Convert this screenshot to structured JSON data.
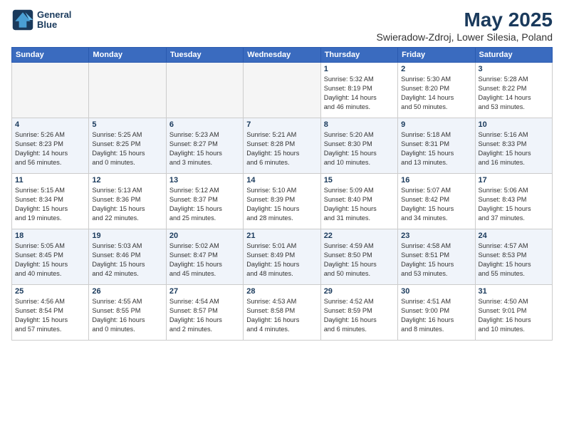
{
  "header": {
    "logo_line1": "General",
    "logo_line2": "Blue",
    "title": "May 2025",
    "subtitle": "Swieradow-Zdroj, Lower Silesia, Poland"
  },
  "weekdays": [
    "Sunday",
    "Monday",
    "Tuesday",
    "Wednesday",
    "Thursday",
    "Friday",
    "Saturday"
  ],
  "weeks": [
    [
      {
        "day": "",
        "info": ""
      },
      {
        "day": "",
        "info": ""
      },
      {
        "day": "",
        "info": ""
      },
      {
        "day": "",
        "info": ""
      },
      {
        "day": "1",
        "info": "Sunrise: 5:32 AM\nSunset: 8:19 PM\nDaylight: 14 hours\nand 46 minutes."
      },
      {
        "day": "2",
        "info": "Sunrise: 5:30 AM\nSunset: 8:20 PM\nDaylight: 14 hours\nand 50 minutes."
      },
      {
        "day": "3",
        "info": "Sunrise: 5:28 AM\nSunset: 8:22 PM\nDaylight: 14 hours\nand 53 minutes."
      }
    ],
    [
      {
        "day": "4",
        "info": "Sunrise: 5:26 AM\nSunset: 8:23 PM\nDaylight: 14 hours\nand 56 minutes."
      },
      {
        "day": "5",
        "info": "Sunrise: 5:25 AM\nSunset: 8:25 PM\nDaylight: 15 hours\nand 0 minutes."
      },
      {
        "day": "6",
        "info": "Sunrise: 5:23 AM\nSunset: 8:27 PM\nDaylight: 15 hours\nand 3 minutes."
      },
      {
        "day": "7",
        "info": "Sunrise: 5:21 AM\nSunset: 8:28 PM\nDaylight: 15 hours\nand 6 minutes."
      },
      {
        "day": "8",
        "info": "Sunrise: 5:20 AM\nSunset: 8:30 PM\nDaylight: 15 hours\nand 10 minutes."
      },
      {
        "day": "9",
        "info": "Sunrise: 5:18 AM\nSunset: 8:31 PM\nDaylight: 15 hours\nand 13 minutes."
      },
      {
        "day": "10",
        "info": "Sunrise: 5:16 AM\nSunset: 8:33 PM\nDaylight: 15 hours\nand 16 minutes."
      }
    ],
    [
      {
        "day": "11",
        "info": "Sunrise: 5:15 AM\nSunset: 8:34 PM\nDaylight: 15 hours\nand 19 minutes."
      },
      {
        "day": "12",
        "info": "Sunrise: 5:13 AM\nSunset: 8:36 PM\nDaylight: 15 hours\nand 22 minutes."
      },
      {
        "day": "13",
        "info": "Sunrise: 5:12 AM\nSunset: 8:37 PM\nDaylight: 15 hours\nand 25 minutes."
      },
      {
        "day": "14",
        "info": "Sunrise: 5:10 AM\nSunset: 8:39 PM\nDaylight: 15 hours\nand 28 minutes."
      },
      {
        "day": "15",
        "info": "Sunrise: 5:09 AM\nSunset: 8:40 PM\nDaylight: 15 hours\nand 31 minutes."
      },
      {
        "day": "16",
        "info": "Sunrise: 5:07 AM\nSunset: 8:42 PM\nDaylight: 15 hours\nand 34 minutes."
      },
      {
        "day": "17",
        "info": "Sunrise: 5:06 AM\nSunset: 8:43 PM\nDaylight: 15 hours\nand 37 minutes."
      }
    ],
    [
      {
        "day": "18",
        "info": "Sunrise: 5:05 AM\nSunset: 8:45 PM\nDaylight: 15 hours\nand 40 minutes."
      },
      {
        "day": "19",
        "info": "Sunrise: 5:03 AM\nSunset: 8:46 PM\nDaylight: 15 hours\nand 42 minutes."
      },
      {
        "day": "20",
        "info": "Sunrise: 5:02 AM\nSunset: 8:47 PM\nDaylight: 15 hours\nand 45 minutes."
      },
      {
        "day": "21",
        "info": "Sunrise: 5:01 AM\nSunset: 8:49 PM\nDaylight: 15 hours\nand 48 minutes."
      },
      {
        "day": "22",
        "info": "Sunrise: 4:59 AM\nSunset: 8:50 PM\nDaylight: 15 hours\nand 50 minutes."
      },
      {
        "day": "23",
        "info": "Sunrise: 4:58 AM\nSunset: 8:51 PM\nDaylight: 15 hours\nand 53 minutes."
      },
      {
        "day": "24",
        "info": "Sunrise: 4:57 AM\nSunset: 8:53 PM\nDaylight: 15 hours\nand 55 minutes."
      }
    ],
    [
      {
        "day": "25",
        "info": "Sunrise: 4:56 AM\nSunset: 8:54 PM\nDaylight: 15 hours\nand 57 minutes."
      },
      {
        "day": "26",
        "info": "Sunrise: 4:55 AM\nSunset: 8:55 PM\nDaylight: 16 hours\nand 0 minutes."
      },
      {
        "day": "27",
        "info": "Sunrise: 4:54 AM\nSunset: 8:57 PM\nDaylight: 16 hours\nand 2 minutes."
      },
      {
        "day": "28",
        "info": "Sunrise: 4:53 AM\nSunset: 8:58 PM\nDaylight: 16 hours\nand 4 minutes."
      },
      {
        "day": "29",
        "info": "Sunrise: 4:52 AM\nSunset: 8:59 PM\nDaylight: 16 hours\nand 6 minutes."
      },
      {
        "day": "30",
        "info": "Sunrise: 4:51 AM\nSunset: 9:00 PM\nDaylight: 16 hours\nand 8 minutes."
      },
      {
        "day": "31",
        "info": "Sunrise: 4:50 AM\nSunset: 9:01 PM\nDaylight: 16 hours\nand 10 minutes."
      }
    ]
  ]
}
